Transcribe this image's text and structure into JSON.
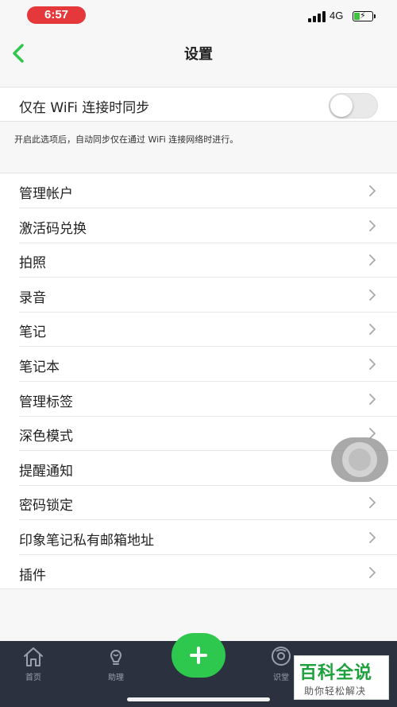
{
  "status_bar": {
    "time": "6:57",
    "network": "4G",
    "battery_level": 0.35
  },
  "nav": {
    "title": "设置",
    "back_icon": "chevron-left-icon"
  },
  "wifi_sync": {
    "label": "仅在 WiFi 连接时同步",
    "enabled": false,
    "hint": "开启此选项后，自动同步仅在通过 WiFi 连接网络时进行。"
  },
  "menu": [
    {
      "label": "管理帐户"
    },
    {
      "label": "激活码兑换"
    },
    {
      "label": "拍照"
    },
    {
      "label": "录音"
    },
    {
      "label": "笔记"
    },
    {
      "label": "笔记本"
    },
    {
      "label": "管理标签"
    },
    {
      "label": "深色模式"
    },
    {
      "label": "提醒通知"
    },
    {
      "label": "密码锁定"
    },
    {
      "label": "印象笔记私有邮箱地址"
    },
    {
      "label": "插件"
    }
  ],
  "tab_bar": {
    "tabs": [
      {
        "label": "首页",
        "icon": "home-icon"
      },
      {
        "label": "助理",
        "icon": "lightbulb-icon"
      },
      {
        "label": "识堂",
        "icon": "compass-icon"
      }
    ],
    "add_icon": "plus-icon"
  },
  "watermark": {
    "title": "百科全说",
    "subtitle": "助你轻松解决"
  },
  "colors": {
    "accent": "#2dc84d",
    "time_pill": "#e5383b",
    "tab_bar": "#2b313f"
  }
}
